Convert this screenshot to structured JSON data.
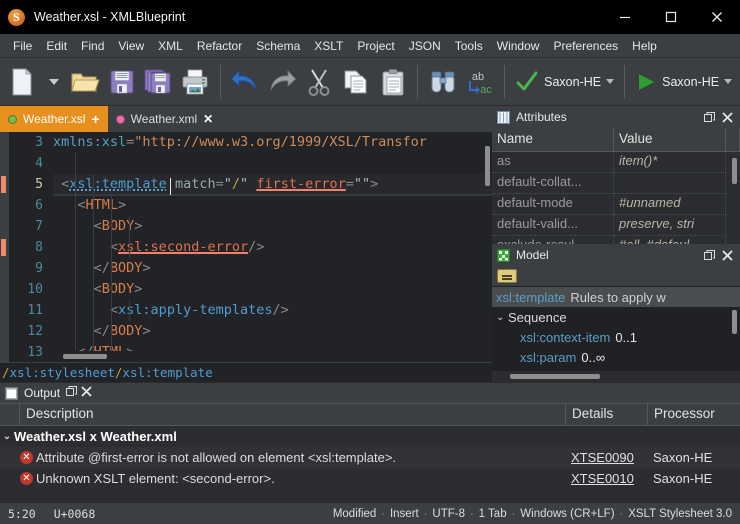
{
  "window": {
    "title": "Weather.xsl - XMLBlueprint",
    "logo_icon": "xmlblueprint-logo-icon",
    "minimize_icon": "minimize-icon",
    "maximize_icon": "maximize-icon",
    "close_icon": "close-icon"
  },
  "menubar": {
    "items": [
      {
        "label": "File"
      },
      {
        "label": "Edit"
      },
      {
        "label": "Find"
      },
      {
        "label": "View"
      },
      {
        "label": "XML"
      },
      {
        "label": "Refactor"
      },
      {
        "label": "Schema"
      },
      {
        "label": "XSLT"
      },
      {
        "label": "Project"
      },
      {
        "label": "JSON"
      },
      {
        "label": "Tools"
      },
      {
        "label": "Window"
      },
      {
        "label": "Preferences"
      },
      {
        "label": "Help"
      }
    ]
  },
  "toolbar": {
    "buttons": [
      {
        "name": "new-file-button",
        "icon": "new-document-icon"
      },
      {
        "name": "new-file-dropdown",
        "icon": "chevron-down-icon"
      },
      {
        "name": "open-file-button",
        "icon": "open-folder-icon"
      },
      {
        "name": "save-button",
        "icon": "floppy-disk-icon"
      },
      {
        "name": "save-all-button",
        "icon": "save-all-icon"
      },
      {
        "name": "print-button",
        "icon": "printer-icon"
      },
      {
        "name": "undo-button",
        "icon": "undo-arrow-icon"
      },
      {
        "name": "redo-button",
        "icon": "redo-arrow-icon"
      },
      {
        "name": "cut-button",
        "icon": "scissors-icon"
      },
      {
        "name": "copy-button",
        "icon": "copy-icon"
      },
      {
        "name": "paste-button",
        "icon": "clipboard-paste-icon"
      },
      {
        "name": "find-button",
        "icon": "binoculars-icon"
      },
      {
        "name": "replace-button",
        "icon": "find-replace-icon"
      }
    ],
    "validate": {
      "label": "Saxon-HE",
      "icon": "green-check-icon",
      "dropdown_icon": "chevron-down-icon"
    },
    "transform": {
      "label": "Saxon-HE",
      "icon": "green-play-icon",
      "dropdown_icon": "chevron-down-icon"
    }
  },
  "tabs": [
    {
      "label": "Weather.xsl",
      "state_icon": "green-dot-icon",
      "action": "+",
      "active": true
    },
    {
      "label": "Weather.xml",
      "state_icon": "pink-dot-icon",
      "action": "✕",
      "active": false
    }
  ],
  "editor": {
    "first_line": 3,
    "current_line": 5,
    "error_lines": [
      5,
      8
    ],
    "lines": [
      {
        "num": "3",
        "text": "xmlns:xsl=\"http://www.w3.org/1999/XSL/Transfor"
      },
      {
        "num": "4",
        "text": ""
      },
      {
        "num": "5",
        "text": "<xsl:template match=\"/\" first-error=\"\">"
      },
      {
        "num": "6",
        "text": "<HTML>"
      },
      {
        "num": "7",
        "text": "<BODY>"
      },
      {
        "num": "8",
        "text": "<xsl:second-error/>"
      },
      {
        "num": "9",
        "text": "</BODY>"
      },
      {
        "num": "10",
        "text": "<BODY>"
      },
      {
        "num": "11",
        "text": "<xsl:apply-templates/>"
      },
      {
        "num": "12",
        "text": "</BODY>"
      },
      {
        "num": "13",
        "text": "</HTML>"
      }
    ]
  },
  "breadcrumb": {
    "path": "/xsl:stylesheet/xsl:template",
    "segments": [
      "xsl:stylesheet",
      "xsl:template"
    ]
  },
  "attributes_panel": {
    "title": "Attributes",
    "icon": "attributes-grid-icon",
    "float_icon": "float-panel-icon",
    "close_icon": "close-icon",
    "columns": [
      "Name",
      "Value"
    ],
    "rows": [
      {
        "name": "as",
        "value": "item()*"
      },
      {
        "name": "default-collat...",
        "value": ""
      },
      {
        "name": "default-mode",
        "value": "#unnamed"
      },
      {
        "name": "default-valid...",
        "value": "preserve, stri"
      },
      {
        "name": "exclude-resul...",
        "value": "#all, #defaul"
      }
    ]
  },
  "model_panel": {
    "title": "Model",
    "icon": "model-tree-icon",
    "float_icon": "float-panel-icon",
    "close_icon": "close-icon",
    "toolbar_button": "model-filter-button",
    "rows": [
      {
        "element": "xsl:template",
        "description": "Rules to apply w",
        "cardinality": "",
        "indent": 0,
        "selected": true,
        "chevron": ""
      },
      {
        "element": "",
        "description": "Sequence",
        "cardinality": "",
        "indent": 0,
        "selected": false,
        "chevron": "⌄"
      },
      {
        "element": "xsl:context-item",
        "description": "",
        "cardinality": "0..1",
        "indent": 1,
        "selected": false,
        "chevron": ""
      },
      {
        "element": "xsl:param",
        "description": "",
        "cardinality": "0..∞",
        "indent": 1,
        "selected": false,
        "chevron": ""
      }
    ]
  },
  "output_panel": {
    "title": "Output",
    "icon": "output-window-icon",
    "float_icon": "float-panel-icon",
    "close_icon": "close-icon",
    "columns": [
      "Description",
      "Details",
      "Processor"
    ],
    "group": {
      "label": "Weather.xsl x Weather.xml",
      "chevron": "⌄"
    },
    "rows": [
      {
        "icon": "error-icon",
        "description": "Attribute @first-error is not allowed on element <xsl:template>.",
        "details": "XTSE0090",
        "processor": "Saxon-HE"
      },
      {
        "icon": "error-icon",
        "description": "Unknown XSLT element: <second-error>.",
        "details": "XTSE0010",
        "processor": "Saxon-HE"
      }
    ]
  },
  "statusbar": {
    "caret": "5:20",
    "codepoint": "U+0068",
    "right_items": [
      "Modified",
      "Insert",
      "UTF-8",
      "1 Tab",
      "Windows (CR+LF)",
      "XSLT Stylesheet 3.0"
    ],
    "separator": "·"
  },
  "colors": {
    "accent_tab": "#e8901e",
    "error": "#c0392b",
    "error_underline": "#f0846a",
    "link": "#5a9ec7",
    "ok_green": "#49b849"
  }
}
